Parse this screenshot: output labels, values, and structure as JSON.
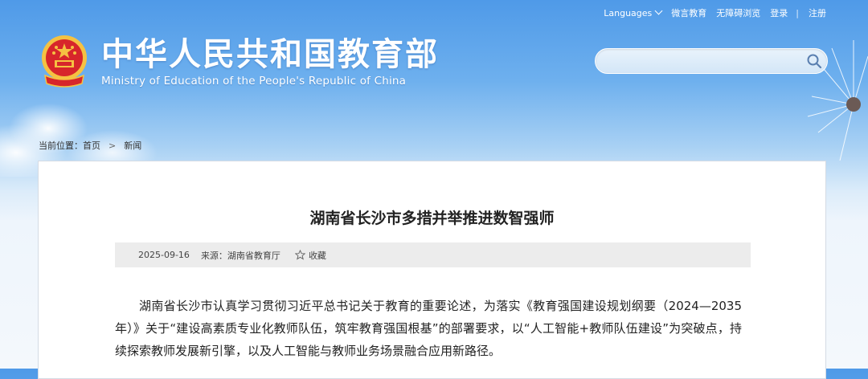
{
  "topbar": {
    "languages": "Languages",
    "wechat": "微言教育",
    "accessibility": "无障碍浏览",
    "login": "登录",
    "separator": "|",
    "register": "注册"
  },
  "brand": {
    "name_cn": "中华人民共和国教育部",
    "name_en": "Ministry of Education of the People's Republic of China"
  },
  "search": {
    "placeholder": ""
  },
  "breadcrumb": {
    "prefix": "当前位置：",
    "home": "首页",
    "current": "新闻"
  },
  "article": {
    "title": "湖南省长沙市多措并举推进数智强师",
    "date": "2025-09-16",
    "source": "来源：湖南省教育厅",
    "favorite": "收藏",
    "paragraph": "湖南省长沙市认真学习贯彻习近平总书记关于教育的重要论述，为落实《教育强国建设规划纲要（2024—2035年）》关于“建设高素质专业化教师队伍，筑牢教育强国根基”的部署要求，以“人工智能+教师队伍建设”为突破点，持续探索教师发展新引擎，以及人工智能与教师业务场景融合应用新路径。"
  },
  "colors": {
    "sky_top": "#4f9ae8",
    "emblem_red": "#d7262b",
    "emblem_gold": "#f5c242",
    "meta_bg": "#ececec"
  }
}
